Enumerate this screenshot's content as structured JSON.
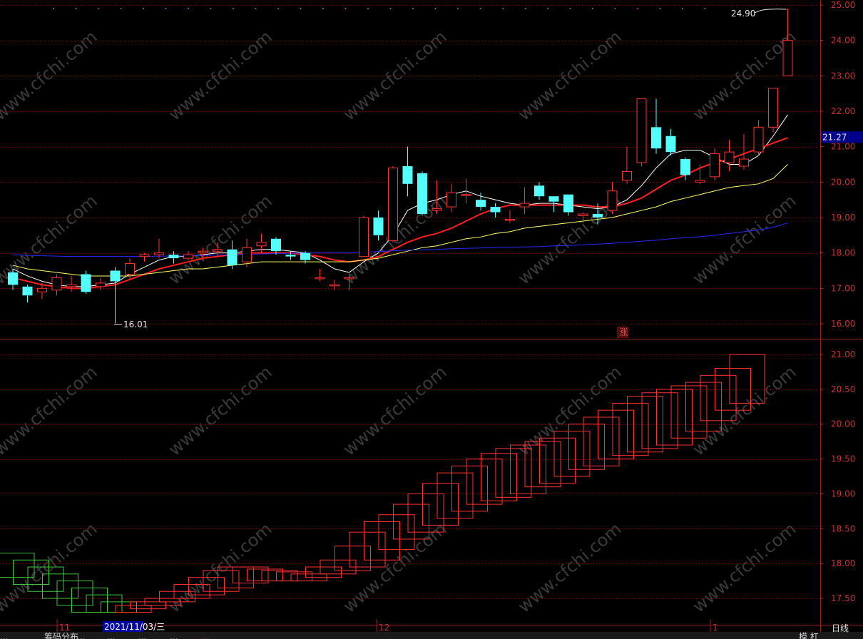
{
  "price_axis_labels": [
    "25.00",
    "24.00",
    "23.00",
    "22.00",
    "21.00",
    "20.00",
    "19.00",
    "18.00",
    "17.00",
    "16.00"
  ],
  "lower_axis_labels": [
    "21.00",
    "20.50",
    "20.00",
    "19.50",
    "19.00",
    "18.50",
    "18.00",
    "17.50"
  ],
  "current_price_tag": "21.27",
  "annotations": {
    "high": "24.90",
    "low": "16.01",
    "zhang_marker": "涨"
  },
  "date_axis": {
    "month_labels": [
      "11",
      "12",
      "1"
    ],
    "cursor_date": "2021/11/03/三"
  },
  "bottom_tabs": [
    "...",
    "筹码分布",
    "...",
    "...",
    "...",
    "...",
    "..."
  ],
  "period_label": "日线",
  "bottom_right_label": "模 杠",
  "watermark": "www.cfchi.com",
  "colors": {
    "up": "#ff3232",
    "down": "#54ffff",
    "ma5": "#ffffff",
    "ma10": "#ff1e1e",
    "ma20": "#ffff64",
    "ma60": "#2828ff",
    "grid": "#8b0000",
    "lower_up": "#ff3232",
    "lower_down": "#3cc83c"
  },
  "chart_data": {
    "type": "candlestick",
    "price_ylim": [
      15.8,
      25.1
    ],
    "candles": [
      [
        17.45,
        17.1,
        17.55,
        16.95
      ],
      [
        17.05,
        16.8,
        17.1,
        16.6
      ],
      [
        16.9,
        17.0,
        17.15,
        16.7
      ],
      [
        16.95,
        17.3,
        17.4,
        16.8
      ],
      [
        17.05,
        17.1,
        17.35,
        16.9
      ],
      [
        17.4,
        16.9,
        17.5,
        16.85
      ],
      [
        17.05,
        17.15,
        17.3,
        16.95
      ],
      [
        17.5,
        17.2,
        17.6,
        16.01
      ],
      [
        17.4,
        17.7,
        17.85,
        17.25
      ],
      [
        17.9,
        17.95,
        18.0,
        17.75
      ],
      [
        17.95,
        18.0,
        18.4,
        17.85
      ],
      [
        17.95,
        17.85,
        18.05,
        17.7
      ],
      [
        17.85,
        17.95,
        18.05,
        17.8
      ],
      [
        18.0,
        18.05,
        18.15,
        17.85
      ],
      [
        18.05,
        18.1,
        18.3,
        17.9
      ],
      [
        18.1,
        17.65,
        18.35,
        17.55
      ],
      [
        17.75,
        18.15,
        18.4,
        17.6
      ],
      [
        18.2,
        18.3,
        18.55,
        18.0
      ],
      [
        18.4,
        18.05,
        18.45,
        17.95
      ],
      [
        17.95,
        17.9,
        18.05,
        17.8
      ],
      [
        18.0,
        17.8,
        18.05,
        17.7
      ],
      [
        17.3,
        17.3,
        17.55,
        17.2
      ],
      [
        17.1,
        17.1,
        17.25,
        16.95
      ],
      [
        17.3,
        17.3,
        17.35,
        16.95
      ],
      [
        17.9,
        19.0,
        19.05,
        17.9
      ],
      [
        19.0,
        18.5,
        19.2,
        18.35
      ],
      [
        18.35,
        20.4,
        20.45,
        18.3
      ],
      [
        20.45,
        19.95,
        21.0,
        19.6
      ],
      [
        20.25,
        19.1,
        20.3,
        19.05
      ],
      [
        19.2,
        19.25,
        20.05,
        19.1
      ],
      [
        19.3,
        19.7,
        19.95,
        19.15
      ],
      [
        19.65,
        19.65,
        20.1,
        19.4
      ],
      [
        19.5,
        19.3,
        19.7,
        19.2
      ],
      [
        19.3,
        19.15,
        19.4,
        19.0
      ],
      [
        18.95,
        18.95,
        19.2,
        18.85
      ],
      [
        19.3,
        19.4,
        19.85,
        19.1
      ],
      [
        19.9,
        19.6,
        20.0,
        19.5
      ],
      [
        19.6,
        19.45,
        19.6,
        19.15
      ],
      [
        19.65,
        19.15,
        19.65,
        19.05
      ],
      [
        19.05,
        19.1,
        19.15,
        18.85
      ],
      [
        19.1,
        19.0,
        19.4,
        18.8
      ],
      [
        19.2,
        19.75,
        20.0,
        19.1
      ],
      [
        20.05,
        20.3,
        21.0,
        19.95
      ],
      [
        20.55,
        22.35,
        22.35,
        20.45
      ],
      [
        21.55,
        20.95,
        22.35,
        20.8
      ],
      [
        21.3,
        20.85,
        21.5,
        20.75
      ],
      [
        20.65,
        20.2,
        20.7,
        20.05
      ],
      [
        20.0,
        20.05,
        20.5,
        19.95
      ],
      [
        20.15,
        20.8,
        20.95,
        20.05
      ],
      [
        20.55,
        20.85,
        21.2,
        20.3
      ],
      [
        20.45,
        20.65,
        21.35,
        20.35
      ],
      [
        20.85,
        21.55,
        21.75,
        20.75
      ],
      [
        21.55,
        22.65,
        22.65,
        21.4
      ],
      [
        23.0,
        24.0,
        24.9,
        23.0
      ]
    ],
    "ma_series": [
      {
        "name": "MA5",
        "values": [
          17.55,
          17.35,
          17.2,
          17.1,
          17.05,
          17.05,
          17.1,
          17.15,
          17.4,
          17.6,
          17.8,
          17.9,
          17.9,
          17.95,
          18.0,
          18.0,
          18.05,
          18.1,
          18.1,
          18.05,
          18.0,
          17.8,
          17.55,
          17.45,
          17.75,
          18.0,
          18.5,
          19.2,
          19.4,
          19.5,
          19.65,
          19.75,
          19.6,
          19.5,
          19.4,
          19.35,
          19.4,
          19.4,
          19.35,
          19.3,
          19.25,
          19.3,
          19.5,
          19.9,
          20.4,
          20.8,
          20.9,
          20.9,
          20.7,
          20.5,
          20.5,
          20.75,
          21.3,
          21.9
        ]
      },
      {
        "name": "MA10",
        "values": [
          17.3,
          17.2,
          17.1,
          17.05,
          17.0,
          17.0,
          17.05,
          17.1,
          17.25,
          17.4,
          17.55,
          17.65,
          17.75,
          17.85,
          17.9,
          17.95,
          18.0,
          18.0,
          18.0,
          18.0,
          17.95,
          17.9,
          17.8,
          17.75,
          17.8,
          17.9,
          18.1,
          18.3,
          18.45,
          18.55,
          18.7,
          18.9,
          19.1,
          19.25,
          19.35,
          19.35,
          19.35,
          19.35,
          19.35,
          19.35,
          19.3,
          19.3,
          19.4,
          19.55,
          19.8,
          20.05,
          20.2,
          20.4,
          20.55,
          20.65,
          20.8,
          20.95,
          21.1,
          21.25
        ]
      },
      {
        "name": "MA20",
        "values": [
          17.65,
          17.55,
          17.5,
          17.45,
          17.4,
          17.35,
          17.35,
          17.35,
          17.35,
          17.4,
          17.45,
          17.5,
          17.55,
          17.55,
          17.6,
          17.65,
          17.7,
          17.75,
          17.75,
          17.75,
          17.75,
          17.75,
          17.75,
          17.75,
          17.8,
          17.85,
          17.95,
          18.05,
          18.15,
          18.2,
          18.3,
          18.4,
          18.45,
          18.55,
          18.6,
          18.7,
          18.75,
          18.8,
          18.85,
          18.9,
          18.95,
          19.0,
          19.1,
          19.2,
          19.3,
          19.45,
          19.55,
          19.65,
          19.75,
          19.85,
          19.9,
          19.95,
          20.1,
          20.5
        ]
      },
      {
        "name": "MA60",
        "values": [
          17.95,
          17.93,
          17.92,
          17.91,
          17.9,
          17.9,
          17.9,
          17.9,
          17.9,
          17.9,
          17.91,
          17.91,
          17.92,
          17.93,
          17.94,
          17.95,
          17.96,
          17.97,
          17.98,
          17.99,
          18.0,
          18.0,
          18.0,
          18.0,
          18.02,
          18.04,
          18.06,
          18.08,
          18.09,
          18.1,
          18.12,
          18.13,
          18.14,
          18.15,
          18.16,
          18.17,
          18.18,
          18.2,
          18.21,
          18.23,
          18.25,
          18.27,
          18.3,
          18.33,
          18.36,
          18.4,
          18.43,
          18.46,
          18.5,
          18.55,
          18.6,
          18.65,
          18.72,
          18.85
        ]
      }
    ],
    "lower_ylim": [
      17.25,
      21.25
    ],
    "lower_boxes": [
      [
        17.8,
        18.15
      ],
      [
        17.7,
        18.05
      ],
      [
        17.6,
        17.95
      ],
      [
        17.5,
        17.85
      ],
      [
        17.4,
        17.75
      ],
      [
        17.3,
        17.65
      ],
      [
        17.3,
        17.55
      ],
      [
        17.3,
        17.45
      ],
      [
        17.3,
        17.4
      ],
      [
        17.35,
        17.45
      ],
      [
        17.4,
        17.5
      ],
      [
        17.45,
        17.6
      ],
      [
        17.5,
        17.7
      ],
      [
        17.55,
        17.8
      ],
      [
        17.6,
        17.9
      ],
      [
        17.65,
        17.95
      ],
      [
        17.72,
        17.95
      ],
      [
        17.75,
        17.92
      ],
      [
        17.75,
        17.9
      ],
      [
        17.75,
        17.88
      ],
      [
        17.75,
        17.85
      ],
      [
        17.8,
        17.95
      ],
      [
        17.85,
        18.05
      ],
      [
        17.9,
        18.25
      ],
      [
        17.95,
        18.45
      ],
      [
        18.05,
        18.6
      ],
      [
        18.2,
        18.7
      ],
      [
        18.35,
        18.85
      ],
      [
        18.45,
        19.0
      ],
      [
        18.55,
        19.15
      ],
      [
        18.65,
        19.3
      ],
      [
        18.75,
        19.4
      ],
      [
        18.85,
        19.5
      ],
      [
        18.9,
        19.58
      ],
      [
        18.95,
        19.65
      ],
      [
        19.0,
        19.7
      ],
      [
        19.1,
        19.75
      ],
      [
        19.15,
        19.8
      ],
      [
        19.25,
        19.9
      ],
      [
        19.35,
        20.0
      ],
      [
        19.4,
        20.1
      ],
      [
        19.5,
        20.2
      ],
      [
        19.55,
        20.3
      ],
      [
        19.6,
        20.4
      ],
      [
        19.65,
        20.45
      ],
      [
        19.7,
        20.5
      ],
      [
        19.8,
        20.55
      ],
      [
        19.9,
        20.6
      ],
      [
        20.05,
        20.7
      ],
      [
        20.2,
        20.8
      ],
      [
        20.3,
        21.0
      ]
    ]
  }
}
